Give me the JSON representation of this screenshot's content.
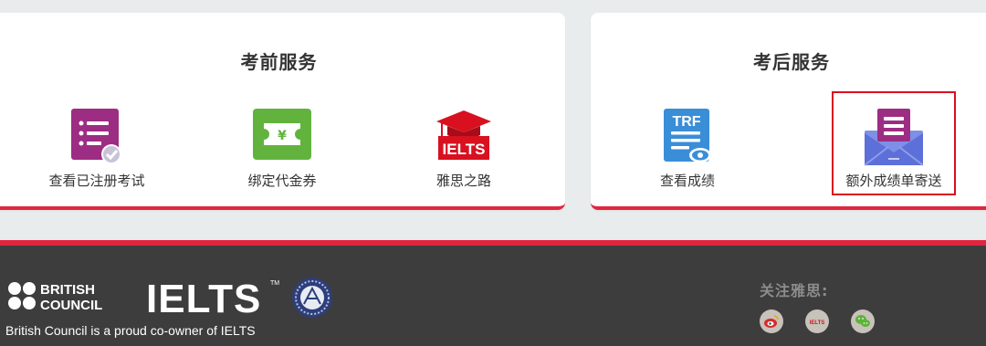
{
  "pre_service": {
    "title": "考前服务",
    "items": [
      {
        "label": "查看已注册考试",
        "icon": "registered-exams-icon"
      },
      {
        "label": "绑定代金券",
        "icon": "voucher-icon"
      },
      {
        "label": "雅思之路",
        "icon": "ielts-road-icon"
      }
    ]
  },
  "post_service": {
    "title": "考后服务",
    "items": [
      {
        "label": "查看成绩",
        "icon": "trf-results-icon"
      },
      {
        "label": "额外成绩单寄送",
        "icon": "mail-transcript-icon"
      }
    ]
  },
  "icon_text": {
    "trf": "TRF",
    "ielts": "IELTS",
    "yen": "¥"
  },
  "footer": {
    "logo_british": "BRITISH",
    "logo_council": "COUNCIL",
    "logo_ielts": "IELTS",
    "logo_tm": "TM",
    "tagline": "British Council is a proud co-owner of IELTS",
    "follow_label": "关注雅思:",
    "social": [
      {
        "name": "weibo-icon"
      },
      {
        "name": "ielts-icon",
        "text": "IELTS"
      },
      {
        "name": "wechat-icon"
      }
    ]
  },
  "colors": {
    "accent_red": "#e0263f",
    "footer_bg": "#3e3d3e",
    "purple": "#9d2d83",
    "green": "#62b33d",
    "blue": "#3a8ed8"
  }
}
